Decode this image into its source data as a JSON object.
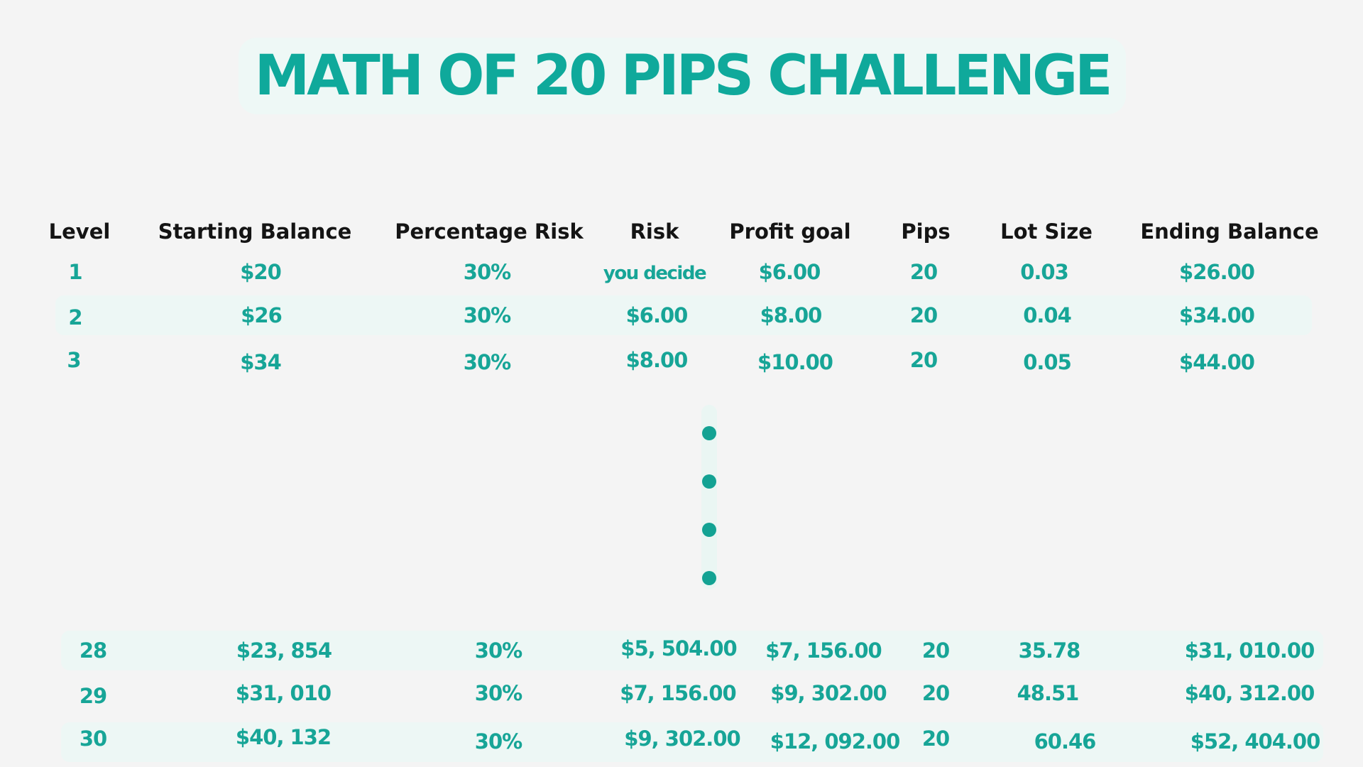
{
  "title": "MATH OF 20 PIPS CHALLENGE",
  "headers": {
    "level": "Level",
    "starting_balance": "Starting Balance",
    "percentage_risk": "Percentage Risk",
    "risk": "Risk",
    "profit_goal": "Profit goal",
    "pips": "Pips",
    "lot_size": "Lot Size",
    "ending_balance": "Ending Balance"
  },
  "rows": [
    {
      "level": "1",
      "starting_balance": "$20",
      "percentage_risk": "30%",
      "risk": "you decide",
      "profit_goal": "$6.00",
      "pips": "20",
      "lot_size": "0.03",
      "ending_balance": "$26.00"
    },
    {
      "level": "2",
      "starting_balance": "$26",
      "percentage_risk": "30%",
      "risk": "$6.00",
      "profit_goal": "$8.00",
      "pips": "20",
      "lot_size": "0.04",
      "ending_balance": "$34.00"
    },
    {
      "level": "3",
      "starting_balance": "$34",
      "percentage_risk": "30%",
      "risk": "$8.00",
      "profit_goal": "$10.00",
      "pips": "20",
      "lot_size": "0.05",
      "ending_balance": "$44.00"
    },
    {
      "level": "28",
      "starting_balance": "$23, 854",
      "percentage_risk": "30%",
      "risk": "$5, 504.00",
      "profit_goal": "$7, 156.00",
      "pips": "20",
      "lot_size": "35.78",
      "ending_balance": "$31, 010.00"
    },
    {
      "level": "29",
      "starting_balance": "$31, 010",
      "percentage_risk": "30%",
      "risk": "$7, 156.00",
      "profit_goal": "$9, 302.00",
      "pips": "20",
      "lot_size": "48.51",
      "ending_balance": "$40, 312.00"
    },
    {
      "level": "30",
      "starting_balance": "$40, 132",
      "percentage_risk": "30%",
      "risk": "$9, 302.00",
      "profit_goal": "$12, 092.00",
      "pips": "20",
      "lot_size": "60.46",
      "ending_balance": "$52, 404.00"
    }
  ],
  "colors": {
    "background": "#f4f4f4",
    "accent": "#0fa99b",
    "row_highlight": "#edf7f5",
    "title_box": "#eef8f6",
    "header_text": "#141414"
  },
  "ellipsis": {
    "icon": "vertical-ellipsis-dots",
    "dot_count": 4
  }
}
